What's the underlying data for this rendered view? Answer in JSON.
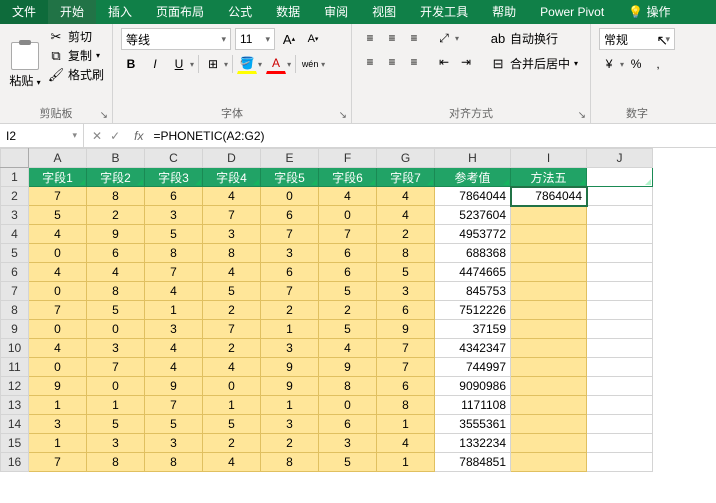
{
  "tabs": {
    "file": "文件",
    "home": "开始",
    "insert": "插入",
    "layout": "页面布局",
    "formulas": "公式",
    "data": "数据",
    "review": "审阅",
    "view": "视图",
    "dev": "开发工具",
    "help": "帮助",
    "pivot": "Power Pivot",
    "tell": "操作"
  },
  "ribbon": {
    "clipboard": {
      "paste": "粘贴",
      "cut": "剪切",
      "copy": "复制",
      "painter": "格式刷",
      "label": "剪贴板"
    },
    "font": {
      "name": "等线",
      "size": "11",
      "bold": "B",
      "italic": "I",
      "underline": "U",
      "wen": "wén",
      "label": "字体"
    },
    "align": {
      "wrap": "自动换行",
      "merge": "合并后居中",
      "label": "对齐方式"
    },
    "number": {
      "format": "常规",
      "pct": "%",
      "comma": ",",
      "label": "数字"
    }
  },
  "fbar": {
    "cell": "I2",
    "formula": "=PHONETIC(A2:G2)"
  },
  "cols": [
    "A",
    "B",
    "C",
    "D",
    "E",
    "F",
    "G",
    "H",
    "I",
    "J"
  ],
  "headers": [
    "字段1",
    "字段2",
    "字段3",
    "字段4",
    "字段5",
    "字段6",
    "字段7",
    "参考值",
    "方法五"
  ],
  "rows": [
    {
      "n": 2,
      "v": [
        "7",
        "8",
        "6",
        "4",
        "0",
        "4",
        "4",
        "7864044",
        "7864044"
      ]
    },
    {
      "n": 3,
      "v": [
        "5",
        "2",
        "3",
        "7",
        "6",
        "0",
        "4",
        "5237604",
        ""
      ]
    },
    {
      "n": 4,
      "v": [
        "4",
        "9",
        "5",
        "3",
        "7",
        "7",
        "2",
        "4953772",
        ""
      ]
    },
    {
      "n": 5,
      "v": [
        "0",
        "6",
        "8",
        "8",
        "3",
        "6",
        "8",
        "688368",
        ""
      ]
    },
    {
      "n": 6,
      "v": [
        "4",
        "4",
        "7",
        "4",
        "6",
        "6",
        "5",
        "4474665",
        ""
      ]
    },
    {
      "n": 7,
      "v": [
        "0",
        "8",
        "4",
        "5",
        "7",
        "5",
        "3",
        "845753",
        ""
      ]
    },
    {
      "n": 8,
      "v": [
        "7",
        "5",
        "1",
        "2",
        "2",
        "2",
        "6",
        "7512226",
        ""
      ]
    },
    {
      "n": 9,
      "v": [
        "0",
        "0",
        "3",
        "7",
        "1",
        "5",
        "9",
        "37159",
        ""
      ]
    },
    {
      "n": 10,
      "v": [
        "4",
        "3",
        "4",
        "2",
        "3",
        "4",
        "7",
        "4342347",
        ""
      ]
    },
    {
      "n": 11,
      "v": [
        "0",
        "7",
        "4",
        "4",
        "9",
        "9",
        "7",
        "744997",
        ""
      ]
    },
    {
      "n": 12,
      "v": [
        "9",
        "0",
        "9",
        "0",
        "9",
        "8",
        "6",
        "9090986",
        ""
      ]
    },
    {
      "n": 13,
      "v": [
        "1",
        "1",
        "7",
        "1",
        "1",
        "0",
        "8",
        "1171108",
        ""
      ]
    },
    {
      "n": 14,
      "v": [
        "3",
        "5",
        "5",
        "5",
        "3",
        "6",
        "1",
        "3555361",
        ""
      ]
    },
    {
      "n": 15,
      "v": [
        "1",
        "3",
        "3",
        "2",
        "2",
        "3",
        "4",
        "1332234",
        ""
      ]
    },
    {
      "n": 16,
      "v": [
        "7",
        "8",
        "8",
        "4",
        "8",
        "5",
        "1",
        "7884851",
        ""
      ]
    }
  ]
}
